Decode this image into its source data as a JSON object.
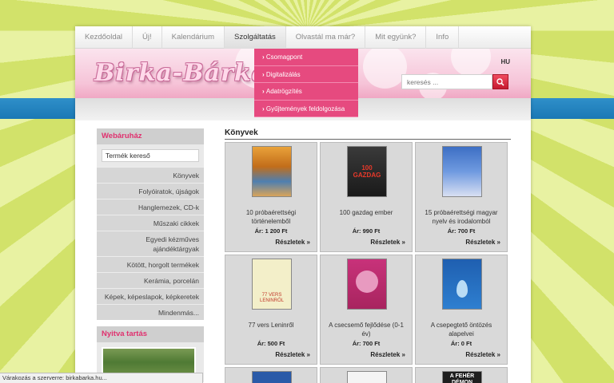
{
  "nav": {
    "items": [
      {
        "label": "Kezdőoldal"
      },
      {
        "label": "Új!"
      },
      {
        "label": "Kalendárium"
      },
      {
        "label": "Szolgáltatás"
      },
      {
        "label": "Olvastál ma már?"
      },
      {
        "label": "Mit együnk?"
      },
      {
        "label": "Info"
      }
    ],
    "active": "Szolgáltatás"
  },
  "dropdown": {
    "items": [
      "Csomagpont",
      "Digitalizálás",
      "Adatrögzítés",
      "Gyűjtemények feldolgozása"
    ]
  },
  "header": {
    "logo_text": "Birka-Bárka",
    "lang": "HU",
    "search_placeholder": "keresés ...",
    "search_icon": "magnifier-icon"
  },
  "sidebar": {
    "shop_title": "Webáruház",
    "product_search_value": "Termék kereső",
    "categories": [
      "Könyvek",
      "Folyóiratok, újságok",
      "Hanglemezek, CD-k",
      "Műszaki cikkek",
      "Egyedi kézműves ajándéktárgyak",
      "Kötött, horgolt termékek",
      "Kerámia, porcelán",
      "Képek, képeslapok, képkeretek",
      "Mindenmás..."
    ],
    "hours_title": "Nyitva tartás"
  },
  "content": {
    "title": "Könyvek",
    "more_label": "Részletek »",
    "products": [
      {
        "name": "10 próbaérettségi történelemből",
        "price": "Ár: 1 200 Ft"
      },
      {
        "name": "100 gazdag ember",
        "price": "Ár: 990 Ft"
      },
      {
        "name": "15 próbaérettségi magyar nyelv és irodalomból",
        "price": "Ár: 700 Ft"
      },
      {
        "name": "77 vers Leninről",
        "price": "Ár: 500 Ft"
      },
      {
        "name": "A csecsemő fejlődése (0-1 év)",
        "price": "Ár: 700 Ft"
      },
      {
        "name": "A csepegtető öntözés alapelvei",
        "price": "Ár: 0 Ft"
      }
    ],
    "cover_texts": [
      "100 GAZDAG",
      "77 VERS LENINRŐL",
      "A FEHÉR DÉMON"
    ]
  },
  "status_bar": {
    "text": "Várakozás a szerverre: birkabarka.hu..."
  },
  "colors": {
    "accent_pink": "#e64a7f",
    "title_pink": "#e0306e",
    "blue_stripe": "#1a78b5",
    "search_red": "#c51a2f"
  }
}
